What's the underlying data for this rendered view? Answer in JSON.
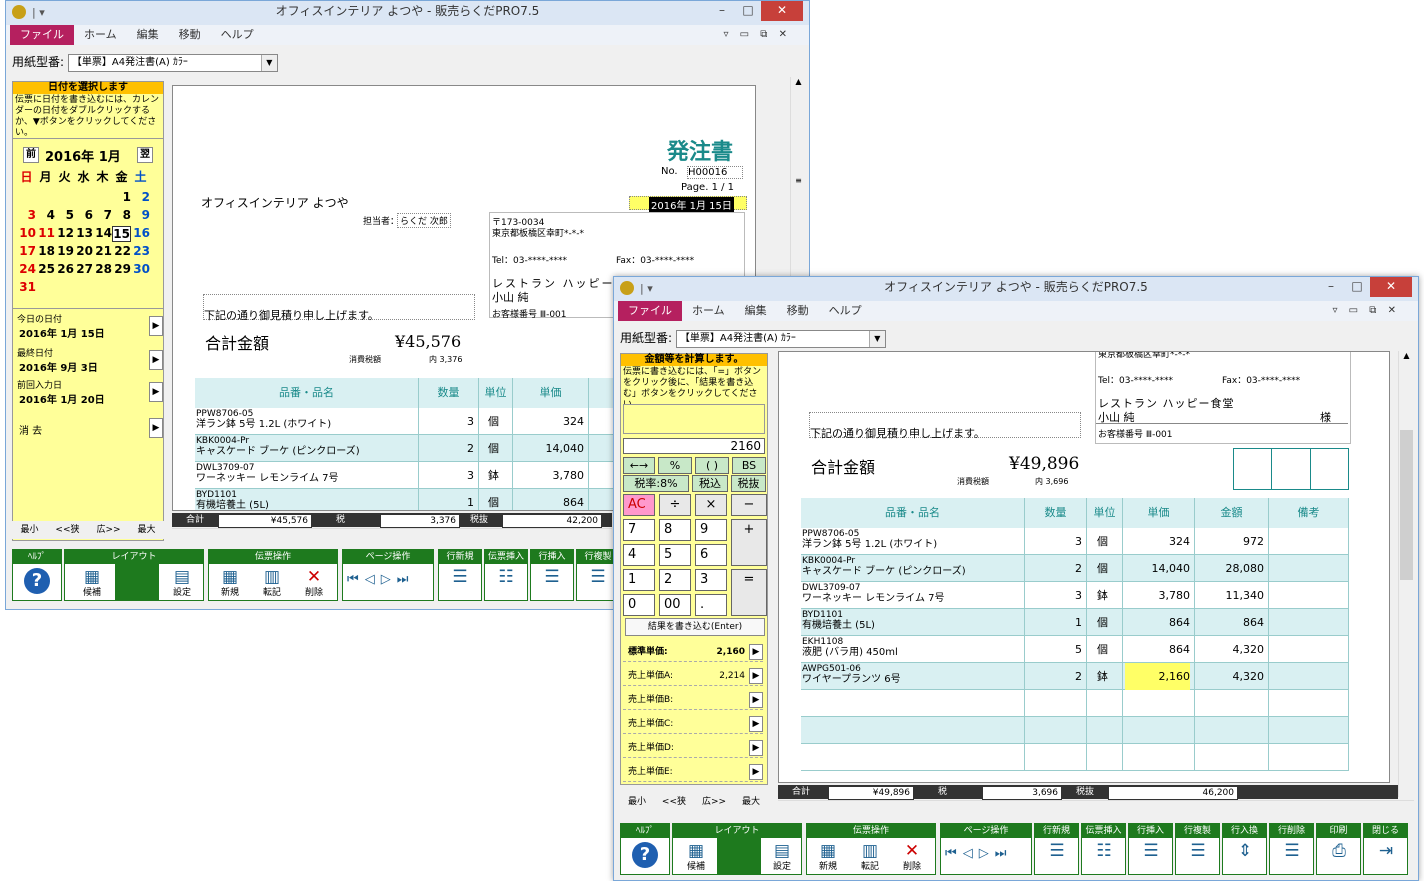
{
  "window1": {
    "title": "オフィスインテリア よつや - 販売らくだPRO7.5",
    "menu": [
      "ファイル",
      "ホーム",
      "編集",
      "移動",
      "ヘルプ"
    ],
    "form_label": "用紙型番:",
    "form_value": "【単票】A4発注書(A) ｶﾗｰ",
    "left_head": "日付を選択します",
    "left_info": "伝票に日付を書き込むには、カレンダーの日付をダブルクリックするか、▼ボタンをクリックしてください。",
    "cal": {
      "prev": "前",
      "title": "2016年 1月",
      "next": "翌",
      "weekdays": [
        "日",
        "月",
        "火",
        "水",
        "木",
        "金",
        "土"
      ],
      "weeks": [
        [
          "",
          "",
          "",
          "",
          "",
          "1",
          "2"
        ],
        [
          "3",
          "4",
          "5",
          "6",
          "7",
          "8",
          "9"
        ],
        [
          "10",
          "11",
          "12",
          "13",
          "14",
          "15",
          "16"
        ],
        [
          "17",
          "18",
          "19",
          "20",
          "21",
          "22",
          "23"
        ],
        [
          "24",
          "25",
          "26",
          "27",
          "28",
          "29",
          "30"
        ],
        [
          "31",
          "",
          "",
          "",
          "",
          "",
          ""
        ]
      ]
    },
    "today_label": "今日の日付",
    "today": "2016年 1月 15日",
    "last_label": "最終日付",
    "last": "2016年 9月 3日",
    "prev_label": "前回入力日",
    "prev": "2016年 1月 20日",
    "clear_label": "消 去",
    "zoom": [
      "最小",
      "<<狭",
      "広>>",
      "最大"
    ],
    "doc": {
      "title": "発注書",
      "no_label": "No.",
      "no": "H00016",
      "page": "Page. 1 / 1",
      "date": "2016年 1月 15日",
      "company": "オフィスインテリア よつや",
      "staff_label": "担当者：",
      "staff": "らくだ 次郎",
      "zip": "〒173-0034",
      "addr": "東京都板橋区幸町*-*-*",
      "tel": "Tel：03-****-****",
      "fax": "Fax：03-****-****",
      "dest": "レストラン ハッピー",
      "dest2": "小山 純",
      "cust": "お客様番号 Ⅲ-001",
      "greeting": "下記の通り御見積り申し上げます。",
      "total_label": "合計金額",
      "total": "¥45,576",
      "tax_label": "消費税額",
      "tax": "内 3,376",
      "headers": [
        "品番・品名",
        "数量",
        "単位",
        "単価",
        "金"
      ],
      "rows": [
        [
          "PPW8706-05",
          "洋ラン鉢 5号 1.2L (ホワイト)",
          "3",
          "個",
          "324"
        ],
        [
          "KBK0004-Pr",
          "キャスケード ブーケ (ピンクローズ)",
          "2",
          "個",
          "14,040"
        ],
        [
          "DWL3709-07",
          "ワーネッキー レモンライム 7号",
          "3",
          "鉢",
          "3,780"
        ],
        [
          "BYD1101",
          "有機培養土 (5L)",
          "1",
          "個",
          "864"
        ]
      ]
    },
    "totals": {
      "sum_label": "合計",
      "sum": "¥45,576",
      "tax_label": "税",
      "tax": "3,376",
      "ex_label": "税抜",
      "ex": "42,200"
    },
    "toolbar": {
      "help": "ﾍﾙﾌﾟ",
      "layout": "レイアウト",
      "voucher": "伝票操作",
      "page": "ページ操作",
      "line": [
        "行新規",
        "伝票挿入",
        "行挿入",
        "行複製"
      ],
      "btns": {
        "candidate": "候補",
        "settings": "設定",
        "new": "新規",
        "transfer": "転記",
        "delete": "削除"
      }
    }
  },
  "window2": {
    "title": "オフィスインテリア よつや - 販売らくだPRO7.5",
    "form_value": "【単票】A4発注書(A) ｶﾗｰ",
    "left_head": "金額等を計算します。",
    "left_info": "伝票に書き込むには、「=」ボタンをクリック後に、「結果を書き込む」ボタンをクリックしてください。",
    "display": "2160",
    "fn_row1": [
      "←→",
      "%",
      "( )",
      "BS"
    ],
    "fn_row2": [
      "税率:8%",
      "税込",
      "税抜"
    ],
    "keys": [
      "AC",
      "÷",
      "×",
      "−",
      "7",
      "8",
      "9",
      "+",
      "4",
      "5",
      "6",
      "1",
      "2",
      "3",
      "=",
      "0",
      "00",
      "."
    ],
    "write_result": "結果を書き込む(Enter)",
    "prices": [
      {
        "label": "標準単価:",
        "value": "2,160"
      },
      {
        "label": "売上単価A:",
        "value": "2,214"
      },
      {
        "label": "売上単価B:",
        "value": ""
      },
      {
        "label": "売上単価C:",
        "value": ""
      },
      {
        "label": "売上単価D:",
        "value": ""
      },
      {
        "label": "売上単価E:",
        "value": ""
      }
    ],
    "doc": {
      "addr_cut": "東京都板橋区幸町*-*-*",
      "tel": "Tel：03-****-****",
      "fax": "Fax：03-****-****",
      "dest": "レストラン ハッピー食堂",
      "dest2": "小山 純",
      "sama": "様",
      "cust": "お客様番号 Ⅲ-001",
      "greeting": "下記の通り御見積り申し上げます。",
      "total_label": "合計金額",
      "total": "¥49,896",
      "tax_label": "消費税額",
      "tax": "内 3,696",
      "headers": [
        "品番・品名",
        "数量",
        "単位",
        "単価",
        "金額",
        "備考"
      ],
      "rows": [
        [
          "PPW8706-05",
          "洋ラン鉢 5号 1.2L (ホワイト)",
          "3",
          "個",
          "324",
          "972"
        ],
        [
          "KBK0004-Pr",
          "キャスケード ブーケ (ピンクローズ)",
          "2",
          "個",
          "14,040",
          "28,080"
        ],
        [
          "DWL3709-07",
          "ワーネッキー レモンライム 7号",
          "3",
          "鉢",
          "3,780",
          "11,340"
        ],
        [
          "BYD1101",
          "有機培養土 (5L)",
          "1",
          "個",
          "864",
          "864"
        ],
        [
          "EKH1108",
          "液肥 (バラ用) 450ml",
          "5",
          "個",
          "864",
          "4,320"
        ],
        [
          "AWPG501-06",
          "ワイヤープランツ 6号",
          "2",
          "鉢",
          "2,160",
          "4,320"
        ]
      ]
    },
    "totals": {
      "sum_label": "合計",
      "sum": "¥49,896",
      "tax_label": "税",
      "tax": "3,696",
      "ex_label": "税抜",
      "ex": "46,200"
    },
    "toolbar_extra": [
      "行新規",
      "伝票挿入",
      "行挿入",
      "行複製",
      "行入換",
      "行削除",
      "印刷",
      "閉じる"
    ]
  }
}
